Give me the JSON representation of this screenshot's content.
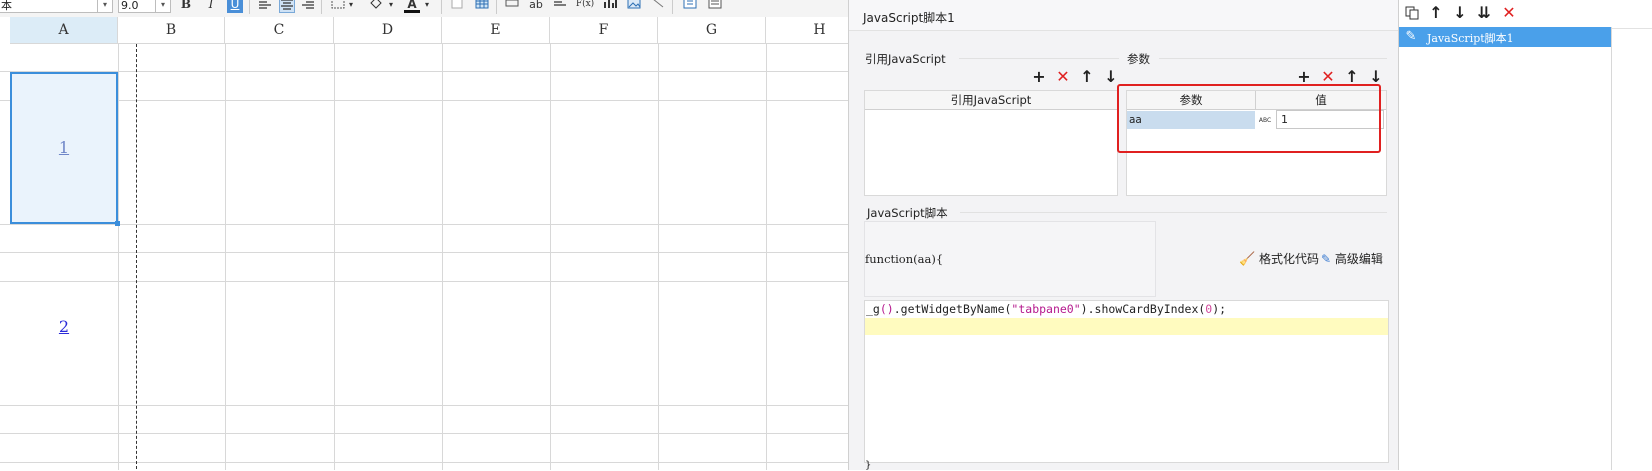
{
  "toolbar": {
    "font_name": "本",
    "font_size": "9.0",
    "dropdown_arrow": "▾",
    "bold": "B",
    "italic": "I",
    "underline": "U",
    "font_color": "A",
    "text_button": "ab",
    "formula_button": "F(x)"
  },
  "sheet": {
    "columns": [
      "A",
      "B",
      "C",
      "D",
      "E",
      "F",
      "G",
      "H"
    ],
    "selected_column": "A",
    "cells": {
      "a_row1": "1",
      "a_row2": "2"
    }
  },
  "dialog": {
    "title": "JavaScript脚本1",
    "import_section": {
      "label": "引用JavaScript",
      "column_header": "引用JavaScript"
    },
    "params_section": {
      "label": "参数",
      "headers": [
        "参数",
        "值"
      ],
      "rows": [
        {
          "name": "aa",
          "type_icon": "ABC",
          "value": "1"
        }
      ]
    },
    "script_section": {
      "label": "JavaScript脚本",
      "function_header": "function(aa){",
      "format_code": "格式化代码",
      "advanced_edit": "高级编辑",
      "code": {
        "prefix": "_g",
        "paren_open": "()",
        "method": ".getWidgetByName(",
        "arg_string": "\"tabpane0\"",
        "close_method": ").showCardByIndex(",
        "index": "0",
        "end": ");"
      },
      "closing_brace": "}"
    },
    "colors": {
      "highlight_border": "#e02020",
      "param_selected_bg": "#c9dcee",
      "code_highlight_line": "#fffbbf",
      "string_color": "#b5198d",
      "number_color": "#d1489a"
    }
  },
  "right_panel": {
    "items": [
      {
        "label": "JavaScript脚本1",
        "selected": true
      }
    ],
    "selection_color": "#4aa0ea"
  }
}
